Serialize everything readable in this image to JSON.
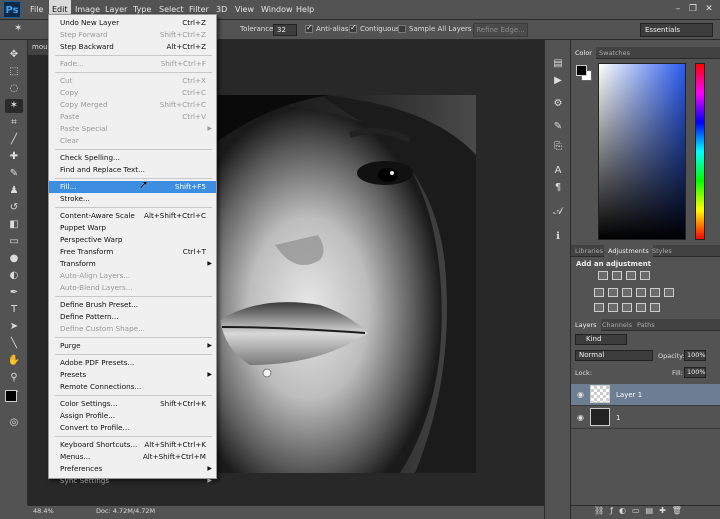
{
  "menubar": {
    "logo": "Ps",
    "items": [
      "File",
      "Edit",
      "Image",
      "Layer",
      "Type",
      "Select",
      "Filter",
      "3D",
      "View",
      "Window",
      "Help"
    ],
    "active": "Edit",
    "win": [
      "–",
      "❐",
      "✕"
    ]
  },
  "options": {
    "tolerance_label": "Tolerance:",
    "tolerance_value": "32",
    "antialias": "Anti-alias",
    "contiguous": "Contiguous",
    "sample_all": "Sample All Layers",
    "refine": "Refine Edge...",
    "workspace": "Essentials"
  },
  "document": {
    "tab": "mou",
    "zoom": "48.4%",
    "doc_info": "Doc: 4.72M/4.72M"
  },
  "edit_menu": [
    {
      "label": "Undo New Layer",
      "shortcut": "Ctrl+Z"
    },
    {
      "label": "Step Forward",
      "shortcut": "Shift+Ctrl+Z"
    },
    {
      "label": "Step Backward",
      "shortcut": "Alt+Ctrl+Z"
    },
    {
      "label": "Fade...",
      "shortcut": "Shift+Ctrl+F"
    },
    {
      "label": "Cut",
      "shortcut": "Ctrl+X"
    },
    {
      "label": "Copy",
      "shortcut": "Ctrl+C"
    },
    {
      "label": "Copy Merged",
      "shortcut": "Shift+Ctrl+C"
    },
    {
      "label": "Paste",
      "shortcut": "Ctrl+V"
    },
    {
      "label": "Paste Special",
      "shortcut": ""
    },
    {
      "label": "Clear",
      "shortcut": ""
    },
    {
      "label": "Check Spelling...",
      "shortcut": ""
    },
    {
      "label": "Find and Replace Text...",
      "shortcut": ""
    },
    {
      "label": "Fill...",
      "shortcut": "Shift+F5"
    },
    {
      "label": "Stroke...",
      "shortcut": ""
    },
    {
      "label": "Content-Aware Scale",
      "shortcut": "Alt+Shift+Ctrl+C"
    },
    {
      "label": "Puppet Warp",
      "shortcut": ""
    },
    {
      "label": "Perspective Warp",
      "shortcut": ""
    },
    {
      "label": "Free Transform",
      "shortcut": "Ctrl+T"
    },
    {
      "label": "Transform",
      "shortcut": ""
    },
    {
      "label": "Auto-Align Layers...",
      "shortcut": ""
    },
    {
      "label": "Auto-Blend Layers...",
      "shortcut": ""
    },
    {
      "label": "Define Brush Preset...",
      "shortcut": ""
    },
    {
      "label": "Define Pattern...",
      "shortcut": ""
    },
    {
      "label": "Define Custom Shape...",
      "shortcut": ""
    },
    {
      "label": "Purge",
      "shortcut": ""
    },
    {
      "label": "Adobe PDF Presets...",
      "shortcut": ""
    },
    {
      "label": "Presets",
      "shortcut": ""
    },
    {
      "label": "Remote Connections...",
      "shortcut": ""
    },
    {
      "label": "Color Settings...",
      "shortcut": "Shift+Ctrl+K"
    },
    {
      "label": "Assign Profile...",
      "shortcut": ""
    },
    {
      "label": "Convert to Profile...",
      "shortcut": ""
    },
    {
      "label": "Keyboard Shortcuts...",
      "shortcut": "Alt+Shift+Ctrl+K"
    },
    {
      "label": "Menus...",
      "shortcut": "Alt+Shift+Ctrl+M"
    },
    {
      "label": "Preferences",
      "shortcut": ""
    },
    {
      "label": "Sync Settings",
      "shortcut": ""
    }
  ],
  "panels": {
    "color_tabs": [
      "Color",
      "Swatches"
    ],
    "adj_tabs": [
      "Libraries",
      "Adjustments",
      "Styles"
    ],
    "adj_title": "Add an adjustment",
    "layer_tabs": [
      "Layers",
      "Channels",
      "Paths"
    ],
    "kind": "Kind",
    "blend": "Normal",
    "opacity_label": "Opacity:",
    "opacity_value": "100%",
    "lock_label": "Lock:",
    "fill_label": "Fill:",
    "fill_value": "100%",
    "layers": [
      "Layer 1",
      "1"
    ]
  },
  "colors": {
    "highlight": "#3d8ee0",
    "menu_bg": "#f0f0f0",
    "ui": "#535353"
  }
}
